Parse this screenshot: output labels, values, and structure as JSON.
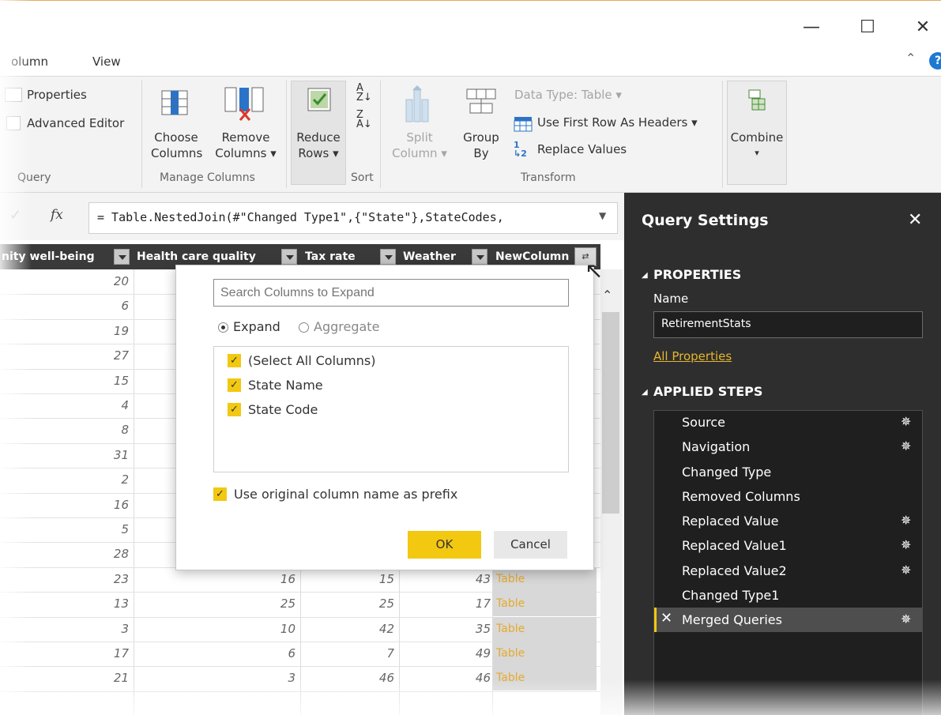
{
  "window": {
    "minimize_glyph": "—",
    "maximize_glyph": "☐",
    "close_glyph": "✕"
  },
  "ribbon_tabs": {
    "column_tab": "olumn",
    "view_tab": "View"
  },
  "ribbon": {
    "properties": "Properties",
    "advanced_editor": "Advanced Editor",
    "query_group": "Query",
    "choose_columns_1": "Choose",
    "choose_columns_2": "Columns",
    "remove_columns_1": "Remove",
    "remove_columns_2": "Columns ▾",
    "manage_columns_group": "Manage Columns",
    "reduce_rows_1": "Reduce",
    "reduce_rows_2": "Rows ▾",
    "sort_group": "Sort",
    "split_column_1": "Split",
    "split_column_2": "Column ▾",
    "group_by_1": "Group",
    "group_by_2": "By",
    "data_type": "Data Type: Table ▾",
    "first_row_headers": "Use First Row As Headers ▾",
    "replace_values": "Replace Values",
    "transform_group": "Transform",
    "combine": "Combine",
    "combine_arrow": "▾"
  },
  "formula_bar": {
    "fx": "fx",
    "formula": "= Table.NestedJoin(#\"Changed Type1\",{\"State\"},StateCodes,"
  },
  "columns": [
    {
      "label": "nity well-being"
    },
    {
      "label": "Health care quality"
    },
    {
      "label": "Tax rate"
    },
    {
      "label": "Weather"
    },
    {
      "label": "NewColumn"
    }
  ],
  "rows": [
    {
      "wellbeing": "20",
      "health": "",
      "tax": "",
      "weather": "",
      "newcol": ""
    },
    {
      "wellbeing": "6",
      "health": "",
      "tax": "",
      "weather": "",
      "newcol": ""
    },
    {
      "wellbeing": "19",
      "health": "",
      "tax": "",
      "weather": "",
      "newcol": ""
    },
    {
      "wellbeing": "27",
      "health": "",
      "tax": "",
      "weather": "",
      "newcol": ""
    },
    {
      "wellbeing": "15",
      "health": "",
      "tax": "",
      "weather": "",
      "newcol": ""
    },
    {
      "wellbeing": "4",
      "health": "",
      "tax": "",
      "weather": "",
      "newcol": ""
    },
    {
      "wellbeing": "8",
      "health": "",
      "tax": "",
      "weather": "",
      "newcol": ""
    },
    {
      "wellbeing": "31",
      "health": "",
      "tax": "",
      "weather": "",
      "newcol": ""
    },
    {
      "wellbeing": "2",
      "health": "",
      "tax": "",
      "weather": "",
      "newcol": ""
    },
    {
      "wellbeing": "16",
      "health": "",
      "tax": "",
      "weather": "",
      "newcol": ""
    },
    {
      "wellbeing": "5",
      "health": "",
      "tax": "",
      "weather": "",
      "newcol": ""
    },
    {
      "wellbeing": "28",
      "health": "",
      "tax": "",
      "weather": "",
      "newcol": ""
    },
    {
      "wellbeing": "23",
      "health": "16",
      "tax": "15",
      "weather": "43",
      "newcol": "Table"
    },
    {
      "wellbeing": "13",
      "health": "25",
      "tax": "25",
      "weather": "17",
      "newcol": "Table"
    },
    {
      "wellbeing": "3",
      "health": "10",
      "tax": "42",
      "weather": "35",
      "newcol": "Table"
    },
    {
      "wellbeing": "17",
      "health": "6",
      "tax": "7",
      "weather": "49",
      "newcol": "Table"
    },
    {
      "wellbeing": "21",
      "health": "3",
      "tax": "46",
      "weather": "46",
      "newcol": "Table"
    }
  ],
  "expand_dialog": {
    "search_placeholder": "Search Columns to Expand",
    "expand_option": "Expand",
    "aggregate_option": "Aggregate",
    "selected_mode": "Expand",
    "columns": [
      {
        "label": "(Select All Columns)",
        "checked": true
      },
      {
        "label": "State Name",
        "checked": true
      },
      {
        "label": "State Code",
        "checked": true
      }
    ],
    "prefix_label": "Use original column name as prefix",
    "prefix_checked": true,
    "ok_label": "OK",
    "cancel_label": "Cancel"
  },
  "query_settings": {
    "title": "Query Settings",
    "close_glyph": "✕",
    "properties_header": "PROPERTIES",
    "name_label": "Name",
    "name_value": "RetirementStats",
    "all_properties": "All Properties",
    "steps_header": "APPLIED STEPS",
    "steps": [
      {
        "label": "Source",
        "gear": true
      },
      {
        "label": "Navigation",
        "gear": true
      },
      {
        "label": "Changed Type",
        "gear": false
      },
      {
        "label": "Removed Columns",
        "gear": false
      },
      {
        "label": "Replaced Value",
        "gear": true
      },
      {
        "label": "Replaced Value1",
        "gear": true
      },
      {
        "label": "Replaced Value2",
        "gear": true
      },
      {
        "label": "Changed Type1",
        "gear": false
      },
      {
        "label": "Merged Queries",
        "gear": true,
        "active": true
      }
    ]
  },
  "colors": {
    "accent": "#f2c811",
    "panel_bg": "#2e2e2e",
    "grid_header_bg": "#3a3a3a",
    "table_link": "#e5aa2c",
    "help_blue": "#1e79d2"
  }
}
